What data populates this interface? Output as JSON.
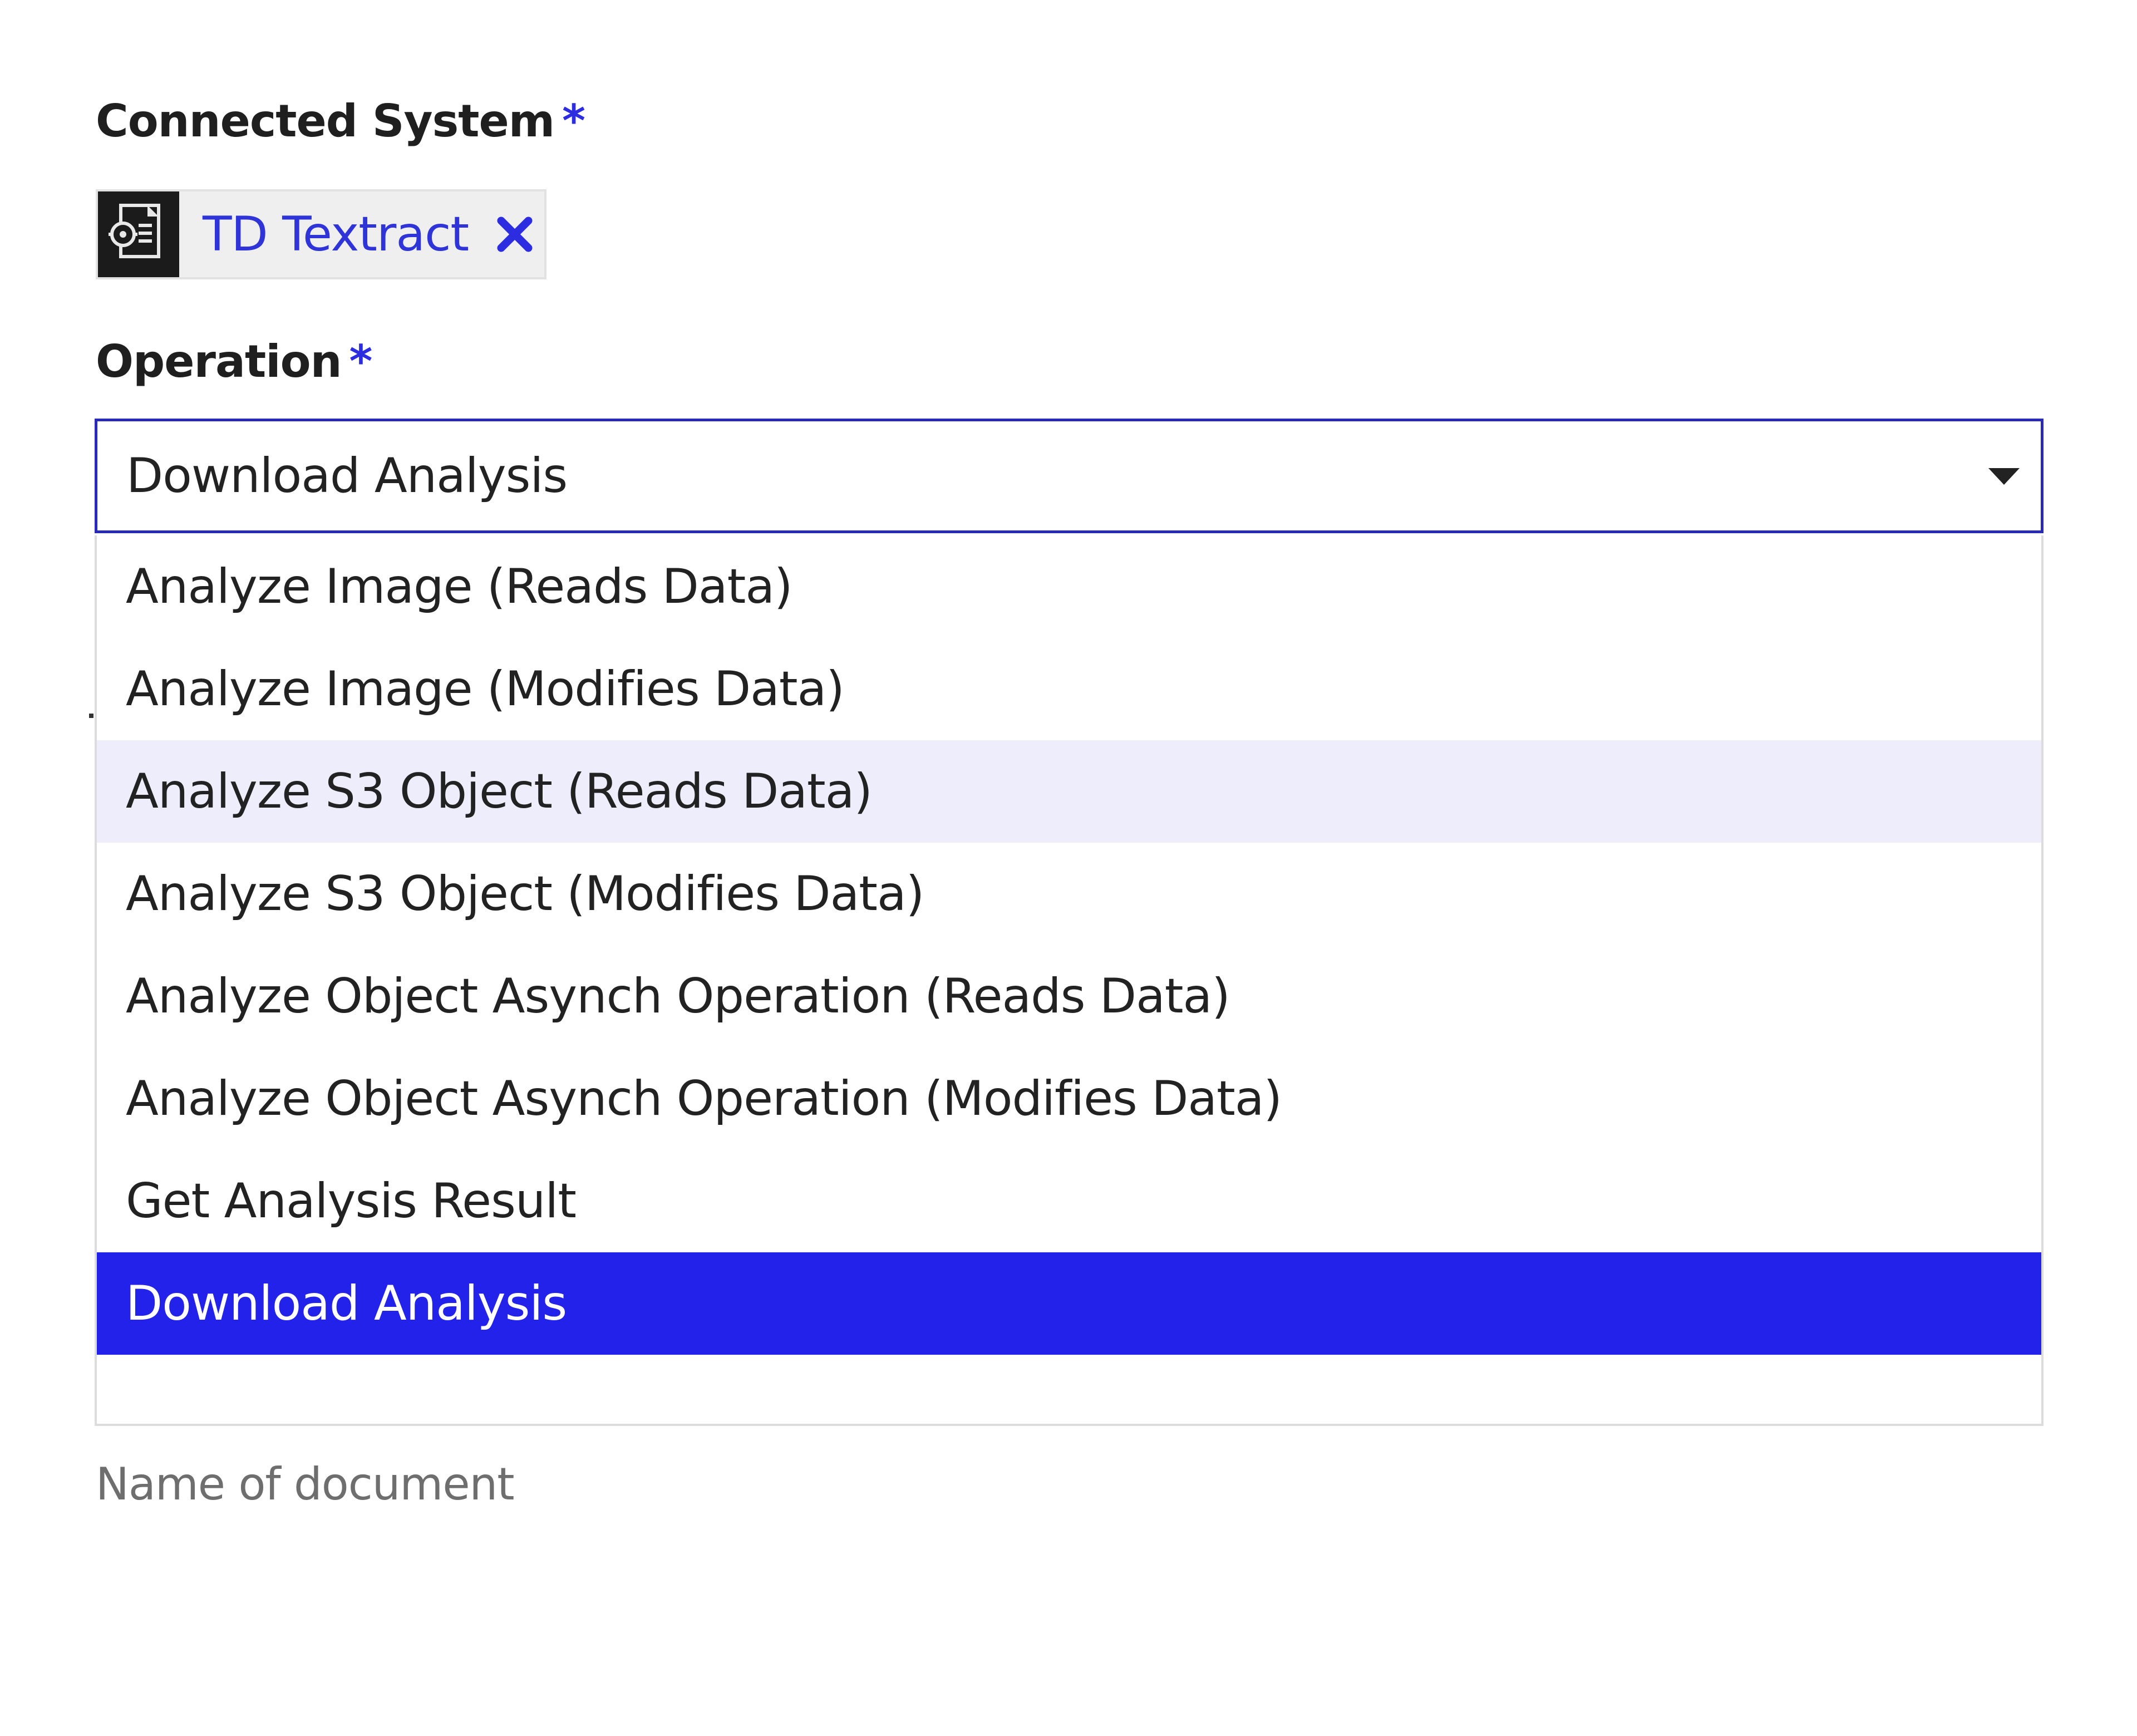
{
  "connected_system": {
    "label": "Connected System",
    "required_marker": "*",
    "chip_label": "TD Textract",
    "icon": "textract-document-icon",
    "remove_icon": "close-x-icon"
  },
  "operation": {
    "label": "Operation",
    "required_marker": "*",
    "selected_value": "Download Analysis",
    "arrow_icon": "caret-down-icon",
    "options": [
      "Analyze Image (Reads Data)",
      "Analyze Image (Modifies Data)",
      "Analyze S3 Object (Reads Data)",
      "Analyze S3 Object (Modifies Data)",
      "Analyze Object Asynch Operation (Reads Data)",
      "Analyze Object Asynch Operation (Modifies Data)",
      "Get Analysis Result",
      "Download Analysis"
    ],
    "hovered_option": "Analyze S3 Object (Reads Data)"
  },
  "helper_text": "Name of document",
  "colors": {
    "accent": "#2222ea",
    "hover": "#ededfb",
    "required": "#2c2ce0",
    "chip_text": "#2f34d8"
  }
}
